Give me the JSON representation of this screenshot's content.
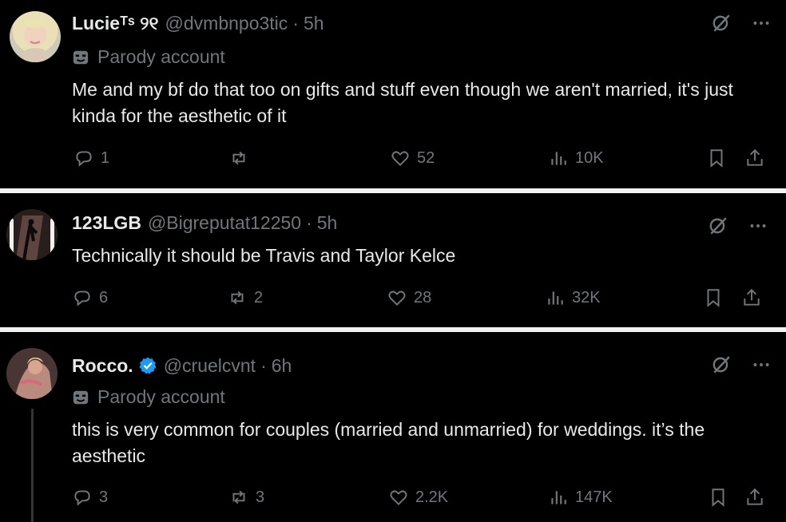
{
  "posts": [
    {
      "author": "Lucieᵀˢ ୨୧",
      "handle": "@dvmbnpo3tic",
      "separator": "·",
      "time": "5h",
      "parody_label": "Parody account",
      "text": "Me and my bf do that too on gifts and stuff even though we aren't married, it's just kinda for the aesthetic of it",
      "replies": "1",
      "reposts": "",
      "likes": "52",
      "views": "10K",
      "verified": false
    },
    {
      "author": "123LGB",
      "handle": "@Bigreputat12250",
      "separator": "·",
      "time": "5h",
      "parody_label": "",
      "text": "Technically it should be Travis and Taylor Kelce",
      "replies": "6",
      "reposts": "2",
      "likes": "28",
      "views": "32K",
      "verified": false
    },
    {
      "author": "Rocco.",
      "handle": "@cruelcvnt",
      "separator": "·",
      "time": "6h",
      "parody_label": "Parody account",
      "text": "this is very common for couples (married and unmarried) for weddings. it’s the aesthetic",
      "replies": "3",
      "reposts": "3",
      "likes": "2.2K",
      "views": "147K",
      "verified": true
    }
  ],
  "colors": {
    "background": "#000000",
    "text": "#e7e9ea",
    "muted": "#71767b",
    "verified": "#1d9bf0",
    "separator": "#f2f2f2"
  },
  "icons": [
    "parody-mask-icon",
    "grok-icon",
    "more-icon",
    "reply-icon",
    "repost-icon",
    "like-icon",
    "views-icon",
    "bookmark-icon",
    "share-icon",
    "verified-badge-icon"
  ]
}
